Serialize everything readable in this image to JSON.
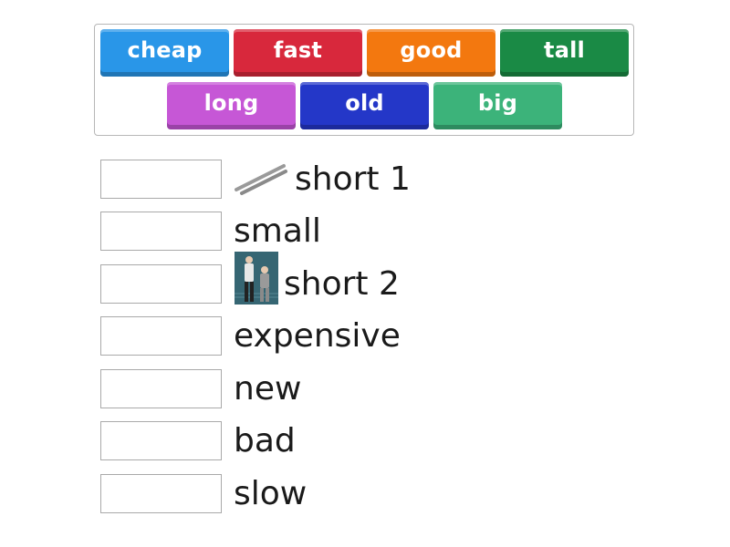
{
  "bank": {
    "tiles": [
      {
        "label": "cheap",
        "color": "#2996e8"
      },
      {
        "label": "fast",
        "color": "#d8283c"
      },
      {
        "label": "good",
        "color": "#f3780f"
      },
      {
        "label": "tall",
        "color": "#1a8a45"
      },
      {
        "label": "long",
        "color": "#c657d6"
      },
      {
        "label": "old",
        "color": "#2437c8"
      },
      {
        "label": "big",
        "color": "#3cb37a"
      }
    ]
  },
  "rows": [
    {
      "word": "short 1",
      "image": "ruler-lines-icon"
    },
    {
      "word": "small"
    },
    {
      "word": "short 2",
      "image": "two-men-photo"
    },
    {
      "word": "expensive"
    },
    {
      "word": "new"
    },
    {
      "word": "bad"
    },
    {
      "word": "slow"
    }
  ]
}
